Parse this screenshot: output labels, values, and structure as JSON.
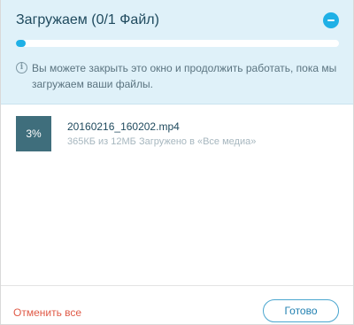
{
  "header": {
    "title": "Загружаем (0/1 Файл)",
    "progress_fraction": 0.03,
    "progress_color": "#1fb0e6",
    "minimize_icon": "minus-circle-icon",
    "info_icon": "info-icon",
    "info_symbol": "i",
    "info_text": "Вы можете закрыть это окно и продолжить работать, пока мы загружаем ваши файлы."
  },
  "files": [
    {
      "thumb_percent": "3%",
      "name": "20160216_160202.mp4",
      "status": "365КБ из 12МБ Загружено в «Все медиа»"
    }
  ],
  "footer": {
    "cancel_all_label": "Отменить все",
    "done_label": "Готово"
  },
  "colors": {
    "header_bg": "#dff1f9",
    "accent": "#1fb0e6",
    "cancel": "#e05a47",
    "thumb_bg": "#3f6e7c"
  }
}
